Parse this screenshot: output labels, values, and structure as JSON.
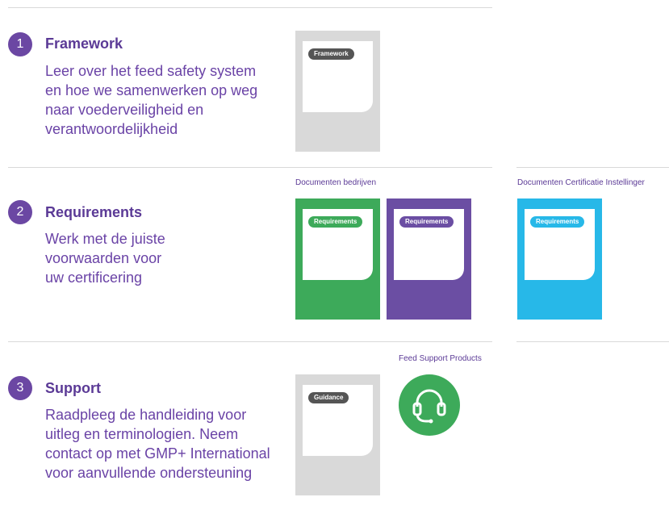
{
  "colors": {
    "purple": "#6b47a3",
    "green": "#3daa5a",
    "cyan": "#27b8e8",
    "grey": "#d9d9d9",
    "tag_dark": "#555555"
  },
  "sections": [
    {
      "number": "1",
      "title": "Framework",
      "body": "Leer over het feed safety system\nen hoe we samenwerken op weg\nnaar voederveiligheid en\nverantwoordelijkheid"
    },
    {
      "number": "2",
      "title": "Requirements",
      "body": "Werk met de juiste\nvoorwaarden voor\nuw certificering"
    },
    {
      "number": "3",
      "title": "Support",
      "body": "Raadpleeg de handleiding voor\nuitleg en terminologien. Neem\ncontact op met GMP+ International\nvoor aanvullende ondersteuning"
    }
  ],
  "captions": {
    "documenten_bedrijven": "Documenten bedrijven",
    "documenten_ci": "Documenten Certificatie Instellinger",
    "feed_support": "Feed Support Products"
  },
  "cards": {
    "framework": "Framework",
    "req_green": "Requirements",
    "req_purple": "Requirements",
    "req_cyan": "Requirements",
    "guidance": "Guidance"
  },
  "icons": {
    "support": "headset-icon"
  }
}
